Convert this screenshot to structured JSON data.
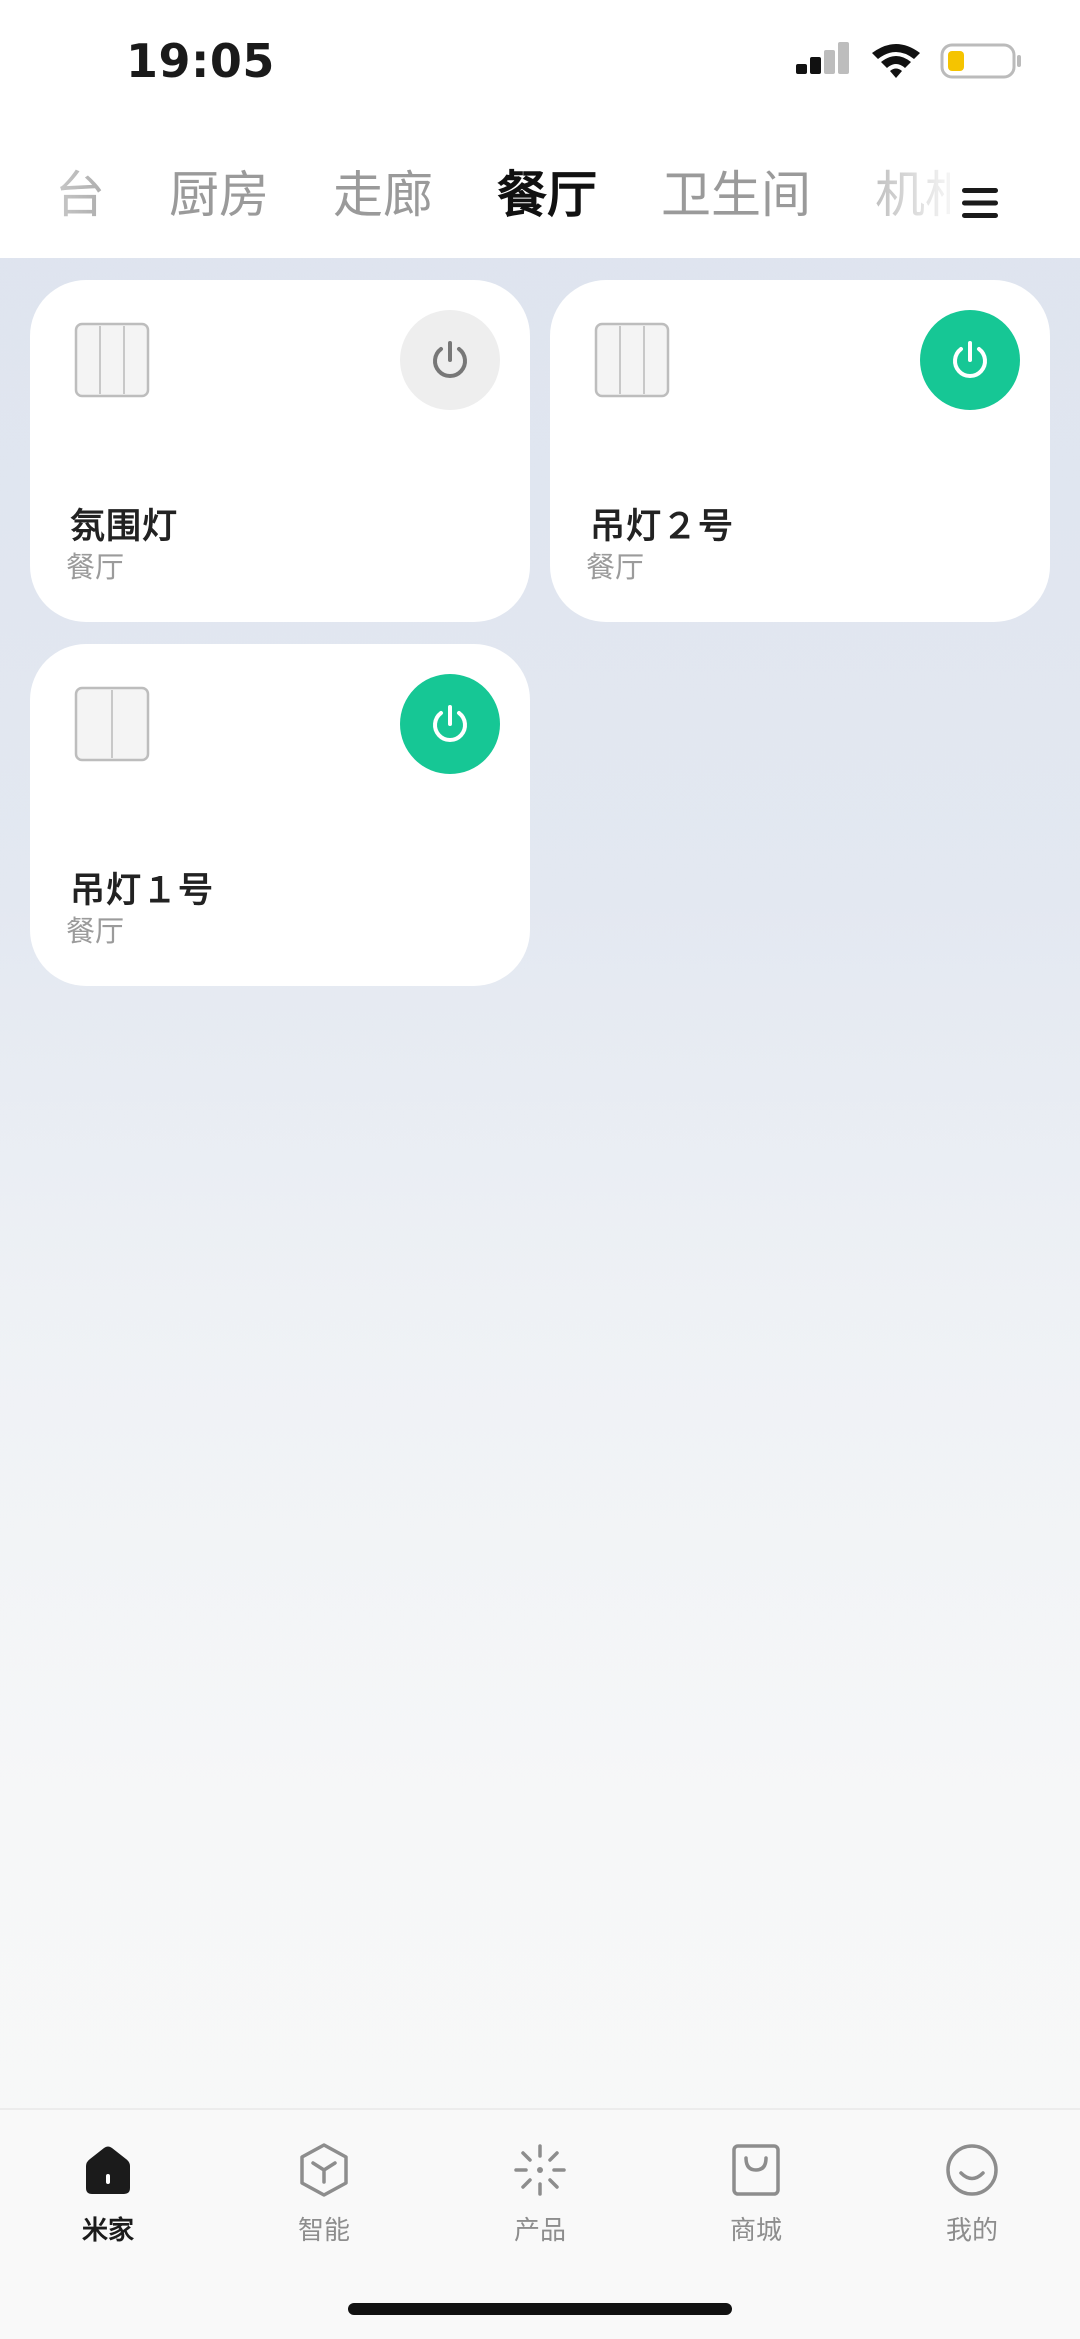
{
  "status_bar": {
    "time": "19:05"
  },
  "room_tabs": {
    "items": [
      {
        "label": "台",
        "active": false
      },
      {
        "label": "厨房",
        "active": false
      },
      {
        "label": "走廊",
        "active": false
      },
      {
        "label": "餐厅",
        "active": true
      },
      {
        "label": "卫生间",
        "active": false
      },
      {
        "label": "机柜",
        "active": false
      }
    ]
  },
  "devices": [
    {
      "name": "氛围灯",
      "room": "餐厅",
      "power": "off"
    },
    {
      "name": "吊灯２号",
      "room": "餐厅",
      "power": "on"
    },
    {
      "name": "吊灯１号",
      "room": "餐厅",
      "power": "on"
    }
  ],
  "bottom_nav": {
    "items": [
      {
        "label": "米家",
        "icon": "home-icon",
        "active": true
      },
      {
        "label": "智能",
        "icon": "cube-icon",
        "active": false
      },
      {
        "label": "产品",
        "icon": "sparkle-icon",
        "active": false
      },
      {
        "label": "商城",
        "icon": "shopping-bag-icon",
        "active": false
      },
      {
        "label": "我的",
        "icon": "smiley-icon",
        "active": false
      }
    ]
  },
  "colors": {
    "accent_green": "#16c795",
    "battery_yellow": "#f5c400"
  }
}
